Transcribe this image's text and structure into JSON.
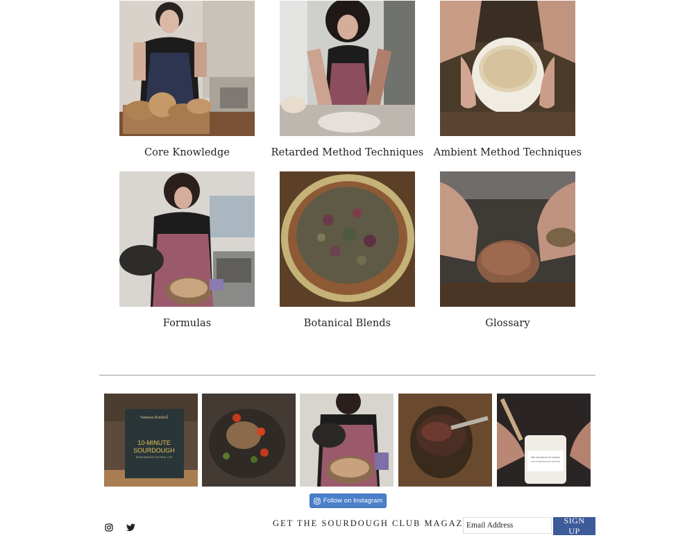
{
  "categories": [
    {
      "label": "Core Knowledge"
    },
    {
      "label": "Retarded Method Techniques"
    },
    {
      "label": "Ambient Method Techniques"
    },
    {
      "label": "Formulas"
    },
    {
      "label": "Botanical Blends"
    },
    {
      "label": "Glossary"
    }
  ],
  "instagram": {
    "follow_label": "Follow on Instagram",
    "book_author": "Vanessa Kimbell",
    "book_title_line1": "10-MINUTE",
    "book_title_line2": "SOURDOUGH",
    "book_subtitle": "BREADMAKING FOR REAL LIFE",
    "jar_label_line1": "THE SOURDOUGH SCHOOL",
    "jar_label_line2": "GREAT MENOPAUSE STARTER"
  },
  "footer": {
    "social_icons": [
      "instagram-icon",
      "twitter-icon"
    ],
    "magazine_label": "GET THE SOURDOUGH CLUB MAGAZINE",
    "email_placeholder": "Email Address",
    "signup_label": "SIGN UP"
  },
  "colors": {
    "follow_button": "#4a7fc9",
    "signup_button": "#3d5a99"
  }
}
